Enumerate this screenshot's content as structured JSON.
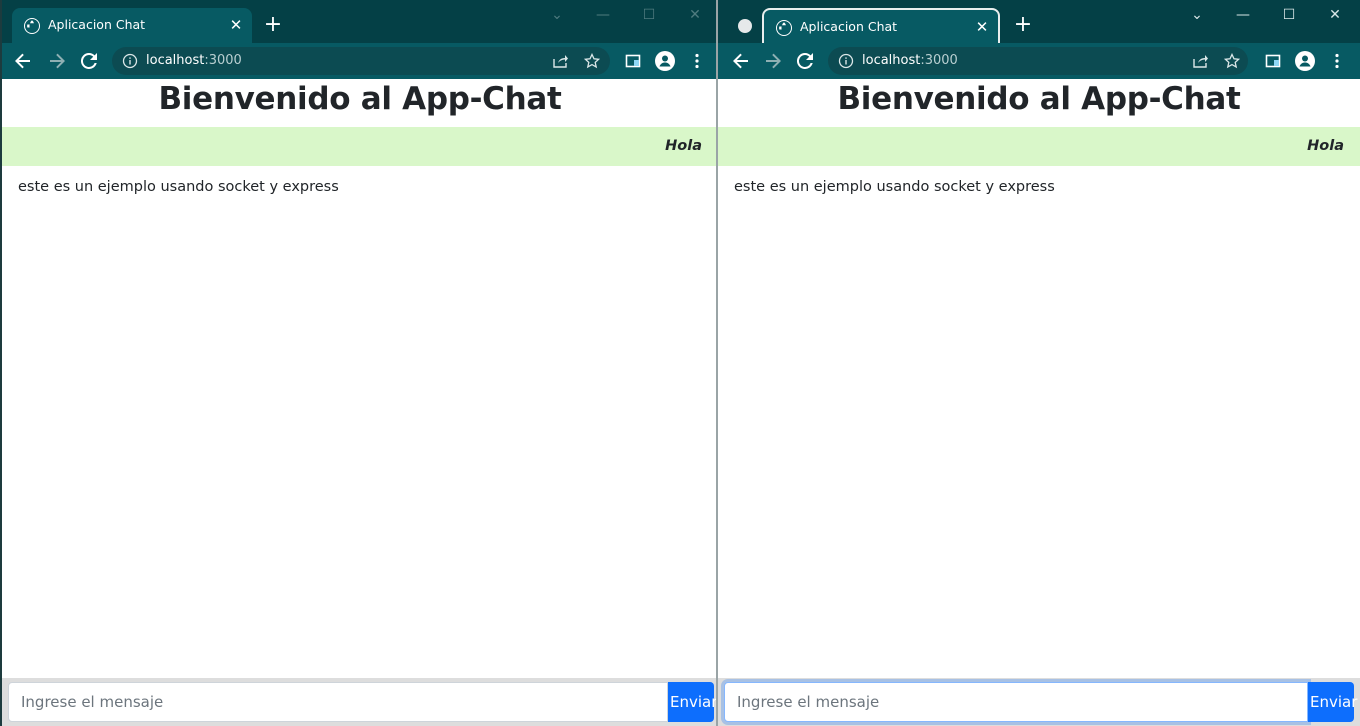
{
  "colors": {
    "tabstrip": "#044046",
    "toolbar": "#075a63",
    "sent_bg": "#d9f7c9",
    "primary": "#0d6efd",
    "footer_bg": "#dddddd"
  },
  "windows": [
    {
      "tab_title": "Aplicacion Chat",
      "url_host": "localhost",
      "url_port": ":3000",
      "page_title": "Bienvenido al App-Chat",
      "sent_message": "Hola",
      "received_message": "este es un ejemplo usando socket y express",
      "input_placeholder": "Ingrese el mensaje",
      "input_value": "",
      "send_label": "Enviar"
    },
    {
      "tab_title": "Aplicacion Chat",
      "url_host": "localhost",
      "url_port": ":3000",
      "page_title": "Bienvenido al App-Chat",
      "sent_message": "Hola",
      "received_message": "este es un ejemplo usando socket y express",
      "input_placeholder": "Ingrese el mensaje",
      "input_value": "",
      "send_label": "Enviar"
    }
  ],
  "icons": {
    "favicon": "globe-icon",
    "close": "close-icon",
    "new_tab": "plus-icon",
    "back": "arrow-left-icon",
    "forward": "arrow-right-icon",
    "reload": "reload-icon",
    "info": "info-icon",
    "share": "share-icon",
    "bookmark": "star-icon",
    "sidepanel": "side-panel-icon",
    "profile": "profile-icon",
    "menu": "kebab-menu-icon",
    "tab_search": "chevron-down-icon",
    "minimize": "minimize-icon",
    "maximize": "maximize-icon",
    "window_close": "window-close-icon"
  }
}
